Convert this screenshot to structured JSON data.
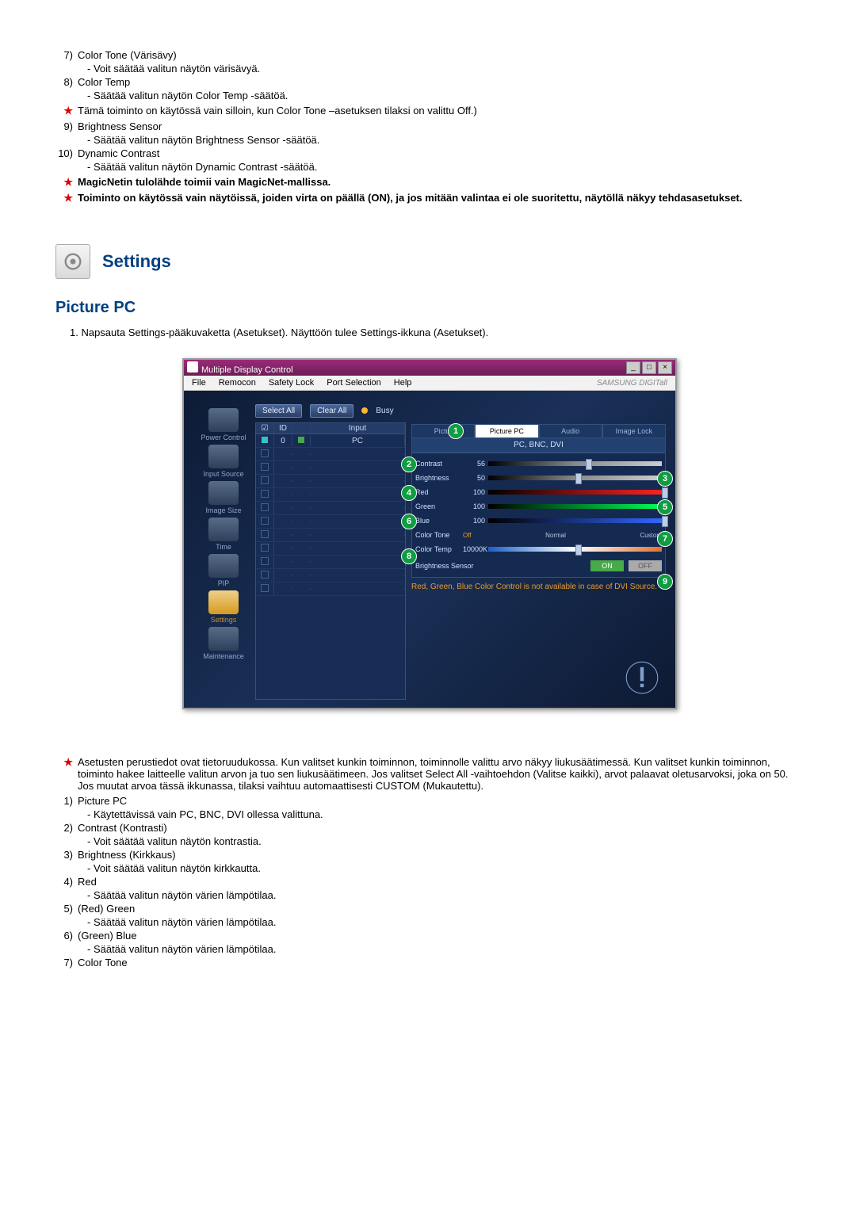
{
  "top_list": [
    {
      "num": "7)",
      "title": "Color Tone (Värisävy)",
      "sub": "- Voit säätää valitun näytön värisävyä."
    },
    {
      "num": "8)",
      "title": "Color Temp",
      "sub": "- Säätää valitun näytön Color Temp -säätöä."
    }
  ],
  "star1": "Tämä toiminto on käytössä vain silloin, kun Color Tone –asetuksen tilaksi on valittu Off.)",
  "list9": {
    "num": "9)",
    "title": "Brightness Sensor",
    "sub": "- Säätää valitun näytön Brightness Sensor -säätöä."
  },
  "list10": {
    "num": "10)",
    "title": "Dynamic Contrast",
    "sub": "- Säätää valitun näytön Dynamic Contrast -säätöä."
  },
  "star2": "MagicNetin tulolähde toimii vain MagicNet-mallissa.",
  "star3": "Toiminto on käytössä vain näytöissä, joiden virta on päällä (ON), ja jos mitään valintaa ei ole suoritettu, näytöllä näkyy tehdasasetukset.",
  "settings_heading": "Settings",
  "picture_pc_heading": "Picture PC",
  "body_text_1": "1. Napsauta Settings-pääkuvaketta (Asetukset). Näyttöön tulee Settings-ikkuna (Asetukset).",
  "window": {
    "title": "Multiple Display Control",
    "menus": [
      "File",
      "Remocon",
      "Safety Lock",
      "Port Selection",
      "Help"
    ],
    "brand": "SAMSUNG DIGITall",
    "select_all": "Select All",
    "clear_all": "Clear All",
    "busy": "Busy",
    "sidebar": [
      {
        "label": "Power Control"
      },
      {
        "label": "Input Source"
      },
      {
        "label": "Image Size"
      },
      {
        "label": "Time"
      },
      {
        "label": "PIP"
      },
      {
        "label": "Settings",
        "selected": true
      },
      {
        "label": "Maintenance"
      }
    ],
    "table_header": [
      "☑",
      "ID",
      "",
      "Input"
    ],
    "table_rows": [
      {
        "id": "0",
        "input": "PC",
        "c1": "w",
        "c3": "g"
      }
    ],
    "tabs": [
      "Pictur",
      "Picture PC",
      "Audio",
      "Image Lock"
    ],
    "active_tab": 1,
    "mode": "PC, BNC, DVI",
    "sliders": [
      {
        "label": "Contrast",
        "val": "56",
        "cls": "color",
        "pos": 56
      },
      {
        "label": "Brightness",
        "val": "50",
        "cls": "color",
        "pos": 50
      },
      {
        "label": "Red",
        "val": "100",
        "cls": "red",
        "pos": 100
      },
      {
        "label": "Green",
        "val": "100",
        "cls": "green",
        "pos": 100
      },
      {
        "label": "Blue",
        "val": "100",
        "cls": "blue",
        "pos": 100
      }
    ],
    "tone": {
      "label": "Color Tone",
      "opts": [
        "Off",
        "Normal",
        "Custom"
      ]
    },
    "temp": {
      "label": "Color Temp",
      "val": "10000K",
      "cls": "rainbow",
      "pos": 50
    },
    "bsensor": {
      "label": "Brightness Sensor",
      "on": "ON",
      "off": "OFF"
    },
    "footnote": "Red, Green, Blue Color Control is not available in case of DVI Source."
  },
  "callouts": [
    "1",
    "2",
    "3",
    "4",
    "5",
    "6",
    "7",
    "8",
    "9"
  ],
  "star4": "Asetusten perustiedot ovat tietoruudukossa. Kun valitset kunkin toiminnon, toiminnolle valittu arvo näkyy liukusäätimessä. Kun valitset kunkin toiminnon, toiminto hakee laitteelle valitun arvon ja tuo sen liukusäätimeen. Jos valitset Select All -vaihtoehdon (Valitse kaikki), arvot palaavat oletusarvoksi, joka on 50. Jos muutat arvoa tässä ikkunassa, tilaksi vaihtuu automaattisesti CUSTOM (Mukautettu).",
  "bottom_list": [
    {
      "num": "1)",
      "title": "Picture PC",
      "sub": "- Käytettävissä vain PC, BNC, DVI ollessa valittuna."
    },
    {
      "num": "2)",
      "title": "Contrast (Kontrasti)",
      "sub": "- Voit säätää valitun näytön kontrastia."
    },
    {
      "num": "3)",
      "title": "Brightness (Kirkkaus)",
      "sub": "- Voit säätää valitun näytön kirkkautta."
    },
    {
      "num": "4)",
      "title": "Red",
      "sub": "- Säätää valitun näytön värien lämpötilaa."
    },
    {
      "num": "5)",
      "title": "(Red) Green",
      "sub": "- Säätää valitun näytön värien lämpötilaa."
    },
    {
      "num": "6)",
      "title": "(Green) Blue",
      "sub": "- Säätää valitun näytön värien lämpötilaa."
    },
    {
      "num": "7)",
      "title": "Color Tone"
    }
  ]
}
